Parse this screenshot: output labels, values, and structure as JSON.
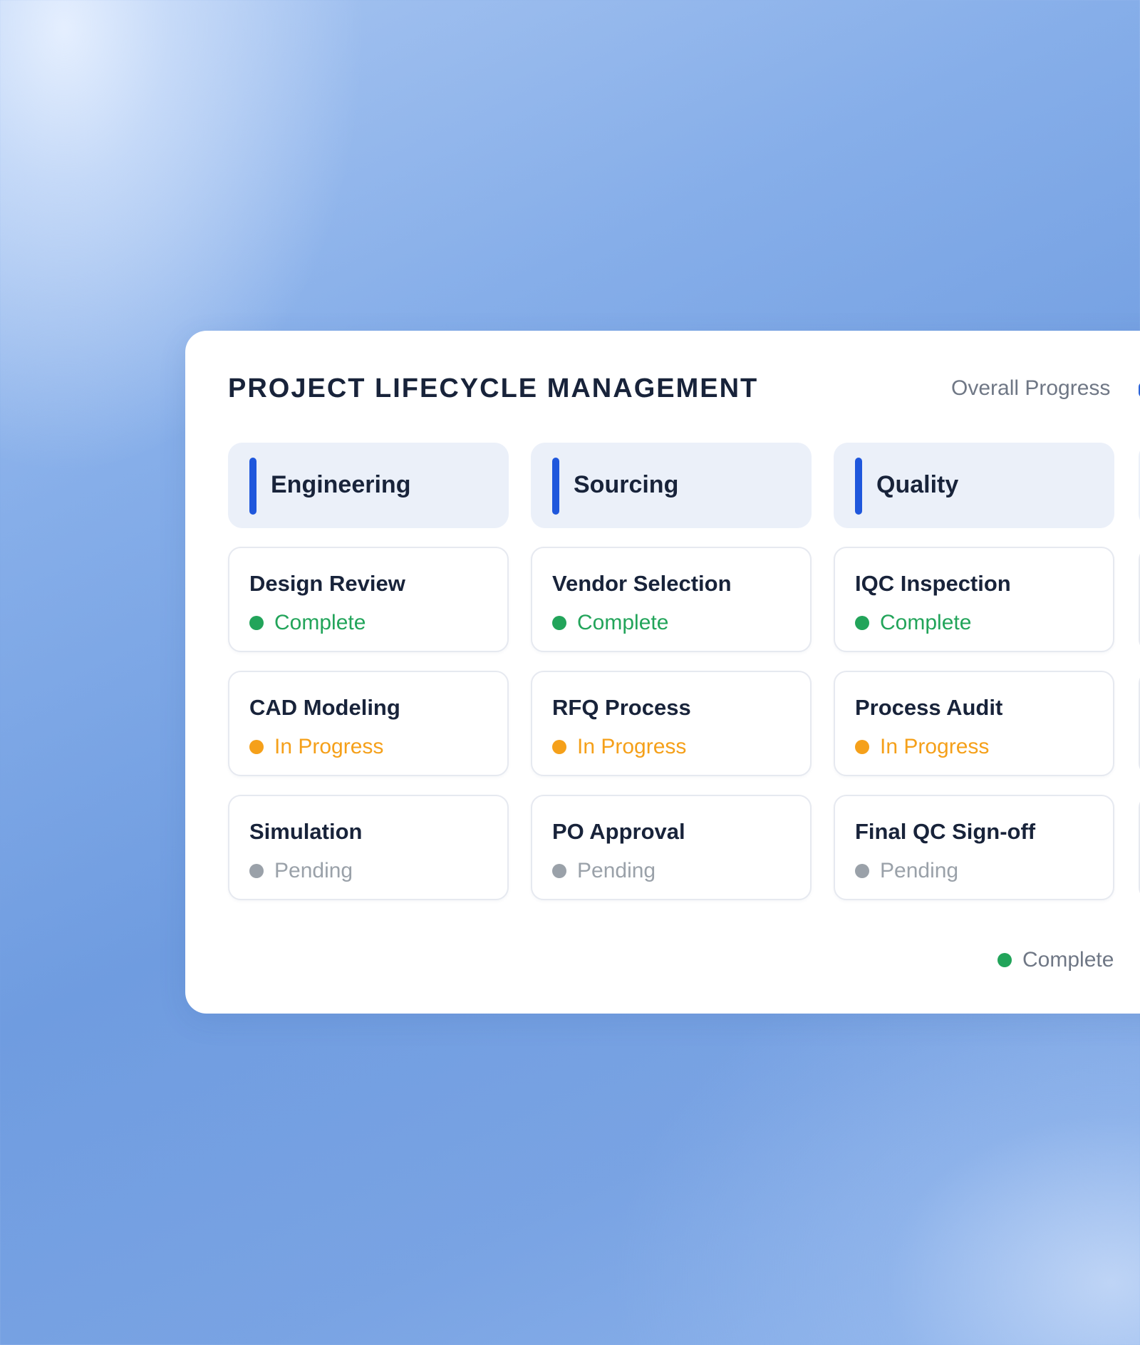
{
  "panel": {
    "title": "PROJECT LIFECYCLE MANAGEMENT",
    "overall_progress_label": "Overall Progress"
  },
  "columns": [
    {
      "title": "Engineering",
      "tasks": [
        {
          "name": "Design Review",
          "status": "Complete"
        },
        {
          "name": "CAD Modeling",
          "status": "In Progress"
        },
        {
          "name": "Simulation",
          "status": "Pending"
        }
      ]
    },
    {
      "title": "Sourcing",
      "tasks": [
        {
          "name": "Vendor Selection",
          "status": "Complete"
        },
        {
          "name": "RFQ Process",
          "status": "In Progress"
        },
        {
          "name": "PO Approval",
          "status": "Pending"
        }
      ]
    },
    {
      "title": "Quality",
      "tasks": [
        {
          "name": "IQC Inspection",
          "status": "Complete"
        },
        {
          "name": "Process Audit",
          "status": "In Progress"
        },
        {
          "name": "Final QC Sign-off",
          "status": "Pending"
        }
      ]
    }
  ],
  "legend": {
    "complete_label": "Complete"
  },
  "colors": {
    "accent": "#1f57dc",
    "complete": "#22a45a",
    "in_progress": "#f5a01a",
    "pending": "#9aa1a9"
  }
}
